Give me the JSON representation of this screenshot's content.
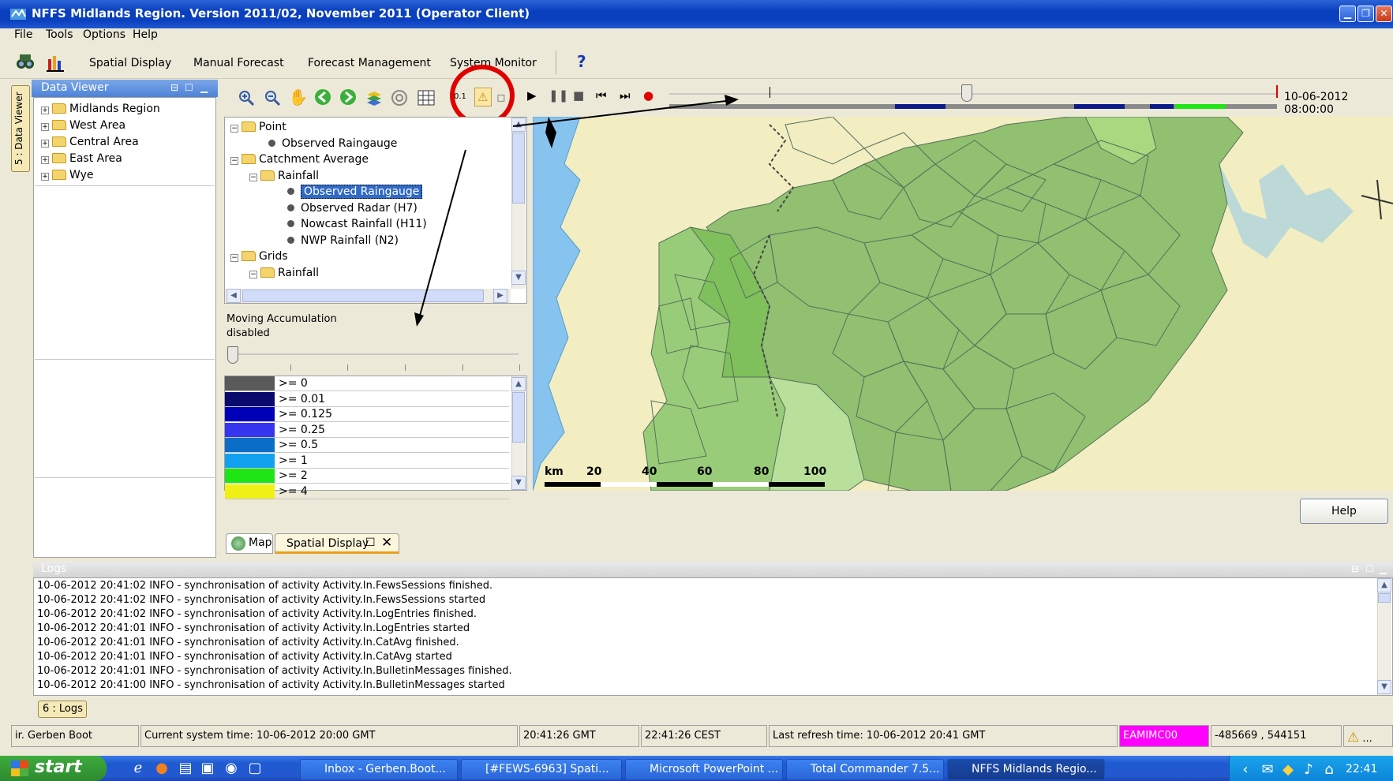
{
  "window": {
    "title": "NFFS Midlands Region. Version 2011/02, November 2011  (Operator Client)"
  },
  "menu": [
    "File",
    "Tools",
    "Options",
    "Help"
  ],
  "toolbar": {
    "items": [
      "Spatial Display",
      "Manual Forecast",
      "Forecast Management",
      "System Monitor"
    ],
    "help_glyph": "?"
  },
  "data_viewer": {
    "title": "Data Viewer",
    "tab_label": "5 : Data Viewer",
    "items": [
      "Midlands Region",
      "West Area",
      "Central Area",
      "East Area",
      "Wye"
    ]
  },
  "spatial": {
    "tree": [
      {
        "label": "Point",
        "kind": "folder"
      },
      {
        "label": "Observed Raingauge",
        "kind": "leaf"
      },
      {
        "label": "Catchment Average",
        "kind": "folder"
      },
      {
        "label": "Rainfall",
        "kind": "folder"
      },
      {
        "label": "Observed Raingauge",
        "kind": "leaf",
        "selected": true
      },
      {
        "label": "Observed Radar (H7)",
        "kind": "leaf"
      },
      {
        "label": "Nowcast Rainfall (H11)",
        "kind": "leaf"
      },
      {
        "label": "NWP Rainfall (N2)",
        "kind": "leaf"
      },
      {
        "label": "Grids",
        "kind": "folder"
      },
      {
        "label": "Rainfall",
        "kind": "folder"
      }
    ],
    "moving_accumulation": {
      "line1": "Moving Accumulation",
      "line2": "disabled"
    },
    "legend": [
      {
        "label": ">= 0",
        "color": "#5a5a5a"
      },
      {
        "label": ">= 0.01",
        "color": "#0a0a6e"
      },
      {
        "label": ">= 0.125",
        "color": "#0000b8"
      },
      {
        "label": ">= 0.25",
        "color": "#3636f0"
      },
      {
        "label": ">= 0.5",
        "color": "#0a6ec8"
      },
      {
        "label": ">= 1",
        "color": "#12a0f0"
      },
      {
        "label": ">= 2",
        "color": "#1ee614"
      },
      {
        "label": ">= 4",
        "color": "#f0f014"
      }
    ],
    "timeline_datetime": "10-06-2012 08:00:00",
    "zoom_label": "0.1",
    "scale": {
      "unit": "km",
      "ticks": [
        "20",
        "40",
        "60",
        "80",
        "100"
      ]
    },
    "help_button": "Help",
    "tabs": [
      "Map",
      "Spatial Display"
    ]
  },
  "logs": {
    "title": "Logs",
    "tab_label": "6 : Logs",
    "lines": [
      "10-06-2012 20:41:02 INFO - synchronisation of activity Activity.In.FewsSessions finished.",
      "10-06-2012 20:41:02 INFO - synchronisation of activity Activity.In.FewsSessions started",
      "10-06-2012 20:41:02 INFO - synchronisation of activity Activity.In.LogEntries finished.",
      "10-06-2012 20:41:01 INFO - synchronisation of activity Activity.In.LogEntries started",
      "10-06-2012 20:41:01 INFO - synchronisation of activity Activity.In.CatAvg finished.",
      "10-06-2012 20:41:01 INFO - synchronisation of activity Activity.In.CatAvg started",
      "10-06-2012 20:41:01 INFO - synchronisation of activity Activity.In.BulletinMessages finished.",
      "10-06-2012 20:41:00 INFO - synchronisation of activity Activity.In.BulletinMessages started"
    ]
  },
  "status": {
    "user": "ir. Gerben Boot",
    "system_time": "Current system time: 10-06-2012 20:00 GMT",
    "gmt": "20:41:26 GMT",
    "cest": "22:41:26 CEST",
    "last_refresh": "Last refresh time: 10-06-2012 20:41 GMT",
    "server": "EAMIMC00",
    "coords": "-485669 , 544151",
    "more": "..."
  },
  "taskbar": {
    "start": "start",
    "tasks": [
      "Inbox - Gerben.Boot...",
      "[#FEWS-6963] Spati...",
      "Microsoft PowerPoint ...",
      "Total Commander 7.5...",
      "NFFS Midlands Regio..."
    ],
    "clock": "22:41"
  },
  "colors": {
    "accent_highlight": "#e00000",
    "map_green": "#8fc46f",
    "map_water": "#86c3ee"
  }
}
